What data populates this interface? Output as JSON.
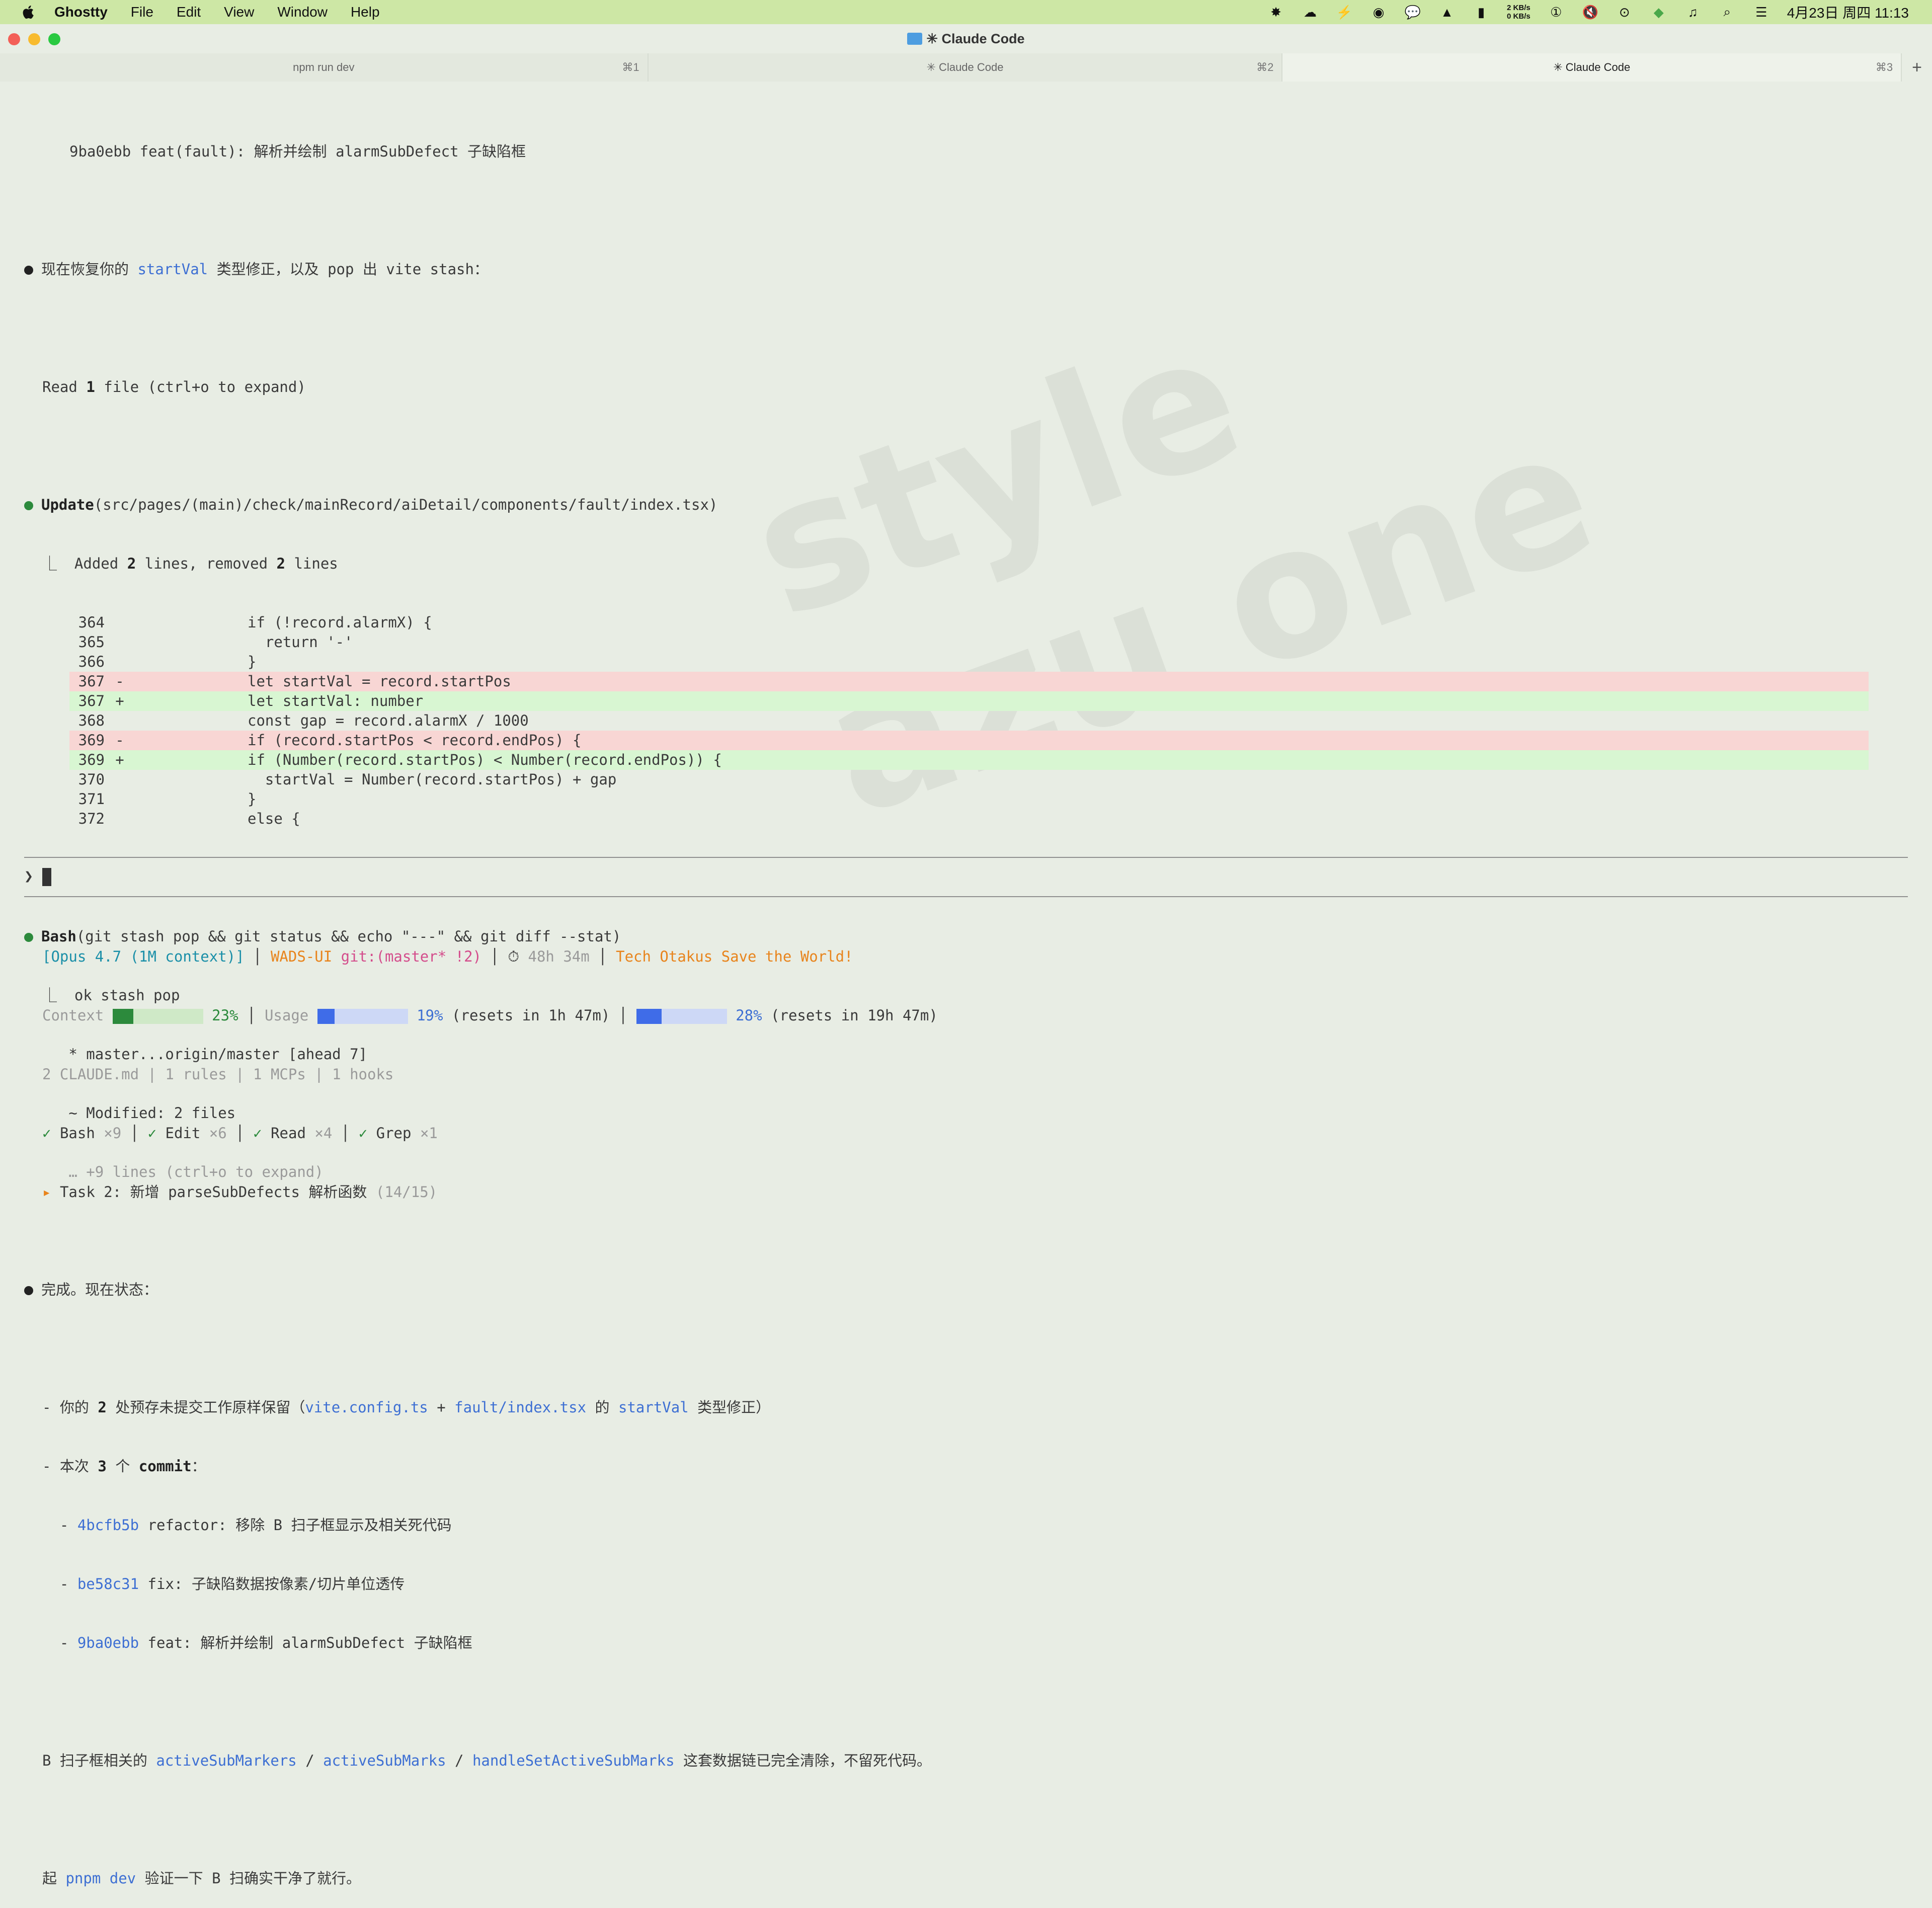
{
  "menubar": {
    "app_name": "Ghostty",
    "menus": [
      "File",
      "Edit",
      "View",
      "Window",
      "Help"
    ],
    "net_up": "2 KB/s",
    "net_down": "0 KB/s",
    "datetime": "4月23日 周四 11:13",
    "status_icons": [
      "claude-icon",
      "cloud-icon",
      "bolt-icon",
      "robot-icon",
      "chat-icon",
      "drive-icon",
      "chart-icon",
      "password-icon",
      "mute-icon",
      "record-icon",
      "wifi-icon",
      "music-icon",
      "search-icon",
      "control-center-icon"
    ]
  },
  "window": {
    "title": "✳ Claude Code"
  },
  "tabs": [
    {
      "label": "npm run dev",
      "shortcut": "⌘1"
    },
    {
      "label": "✳ Claude Code",
      "shortcut": "⌘2"
    },
    {
      "label": "✳ Claude Code",
      "shortcut": "⌘3"
    }
  ],
  "terminal": {
    "l1": "9ba0ebb feat(fault): 解析并绘制 alarmSubDefect 子缺陷框",
    "l2a": "现在恢复你的 ",
    "l2b": "startVal",
    "l2c": " 类型修正，以及 pop 出 vite stash：",
    "l3a": "Read ",
    "l3b": "1",
    "l3c": " file (ctrl+o to expand)",
    "update_a": "Update",
    "update_b": "(src/pages/(main)/check/mainRecord/aiDetail/components/fault/index.tsx)",
    "added_a": "⎿  Added ",
    "added_b": "2",
    "added_c": " lines, removed ",
    "added_d": "2",
    "added_e": " lines",
    "diff": [
      {
        "n": "364",
        "m": " ",
        "code": "if (!record.alarmX) {"
      },
      {
        "n": "365",
        "m": " ",
        "code": "  return '-'"
      },
      {
        "n": "366",
        "m": " ",
        "code": "}"
      },
      {
        "n": "367",
        "m": "-",
        "code": "let startVal = record.startPos"
      },
      {
        "n": "367",
        "m": "+",
        "code": "let startVal: number"
      },
      {
        "n": "368",
        "m": " ",
        "code": "const gap = record.alarmX / 1000"
      },
      {
        "n": "369",
        "m": "-",
        "code": "if (record.startPos < record.endPos) {"
      },
      {
        "n": "369",
        "m": "+",
        "code": "if (Number(record.startPos) < Number(record.endPos)) {"
      },
      {
        "n": "370",
        "m": " ",
        "code": "  startVal = Number(record.startPos) + gap"
      },
      {
        "n": "371",
        "m": " ",
        "code": "}"
      },
      {
        "n": "372",
        "m": " ",
        "code": "else {"
      }
    ],
    "bash_a": "Bash",
    "bash_b": "(git stash pop && git status && echo \"---\" && git diff --stat)",
    "bash_out1": "⎿  ok stash pop",
    "bash_out2": "   * master...origin/master [ahead 7]",
    "bash_out3": "   ~ Modified: 2 files",
    "bash_out4": "   … +9 lines (ctrl+o to expand)",
    "done": "完成。现在状态：",
    "s1a": "- 你的 ",
    "s1b": "2",
    "s1c": " 处预存未提交工作原样保留（",
    "s1d": "vite.config.ts",
    "s1e": " + ",
    "s1f": "fault/index.tsx",
    "s1g": " 的 ",
    "s1h": "startVal",
    "s1i": " 类型修正）",
    "s2a": "- 本次 ",
    "s2b": "3",
    "s2c": " 个 ",
    "s2d": "commit",
    "s2e": "：",
    "c1a": "  - ",
    "c1b": "4bcfb5b",
    "c1c": " refactor: 移除 B 扫子框显示及相关死代码",
    "c2a": "  - ",
    "c2b": "be58c31",
    "c2c": " fix: 子缺陷数据按像素/切片单位透传",
    "c3a": "  - ",
    "c3b": "9ba0ebb",
    "c3c": " feat: 解析并绘制 alarmSubDefect 子缺陷框",
    "b1a": "B 扫子框相关的 ",
    "b1b": "activeSubMarkers",
    "b1c": " / ",
    "b1d": "activeSubMarks",
    "b1e": " / ",
    "b1f": "handleSetActiveSubMarks",
    "b1g": " 这套数据链已完全清除，不留死代码。",
    "q1a": "起 ",
    "q1b": "pnpm dev",
    "q1c": " 验证一下 B 扫确实干净了就行。",
    "prompt": "❯"
  },
  "status": {
    "model": "[Opus 4.7 (1M context)]",
    "project": "WADS-UI",
    "git": "git:(master* !2)",
    "timer": "48h 34m",
    "slogan": "Tech Otakus Save the World!",
    "context_label": "Context",
    "context_pct": "23%",
    "context_value": 0.23,
    "usage_label": "Usage",
    "usage_pct": "19%",
    "usage_value": 0.19,
    "usage_reset": "(resets in 1h 47m)",
    "usage2_pct": "28%",
    "usage2_value": 0.28,
    "usage2_reset": "(resets in 19h 47m)",
    "info": "2 CLAUDE.md | 1 rules | 1 MCPs | 1 hooks",
    "tools": [
      {
        "name": "Bash",
        "count": "×9"
      },
      {
        "name": "Edit",
        "count": "×6"
      },
      {
        "name": "Read",
        "count": "×4"
      },
      {
        "name": "Grep",
        "count": "×1"
      }
    ],
    "task": "Task 2: 新增 parseSubDefects 解析函数",
    "task_progress": "(14/15)"
  },
  "colors": {
    "menubar_bg": "#cde7a5",
    "term_bg": "#e8ede4",
    "link_blue": "#3d6fd3",
    "diff_red_bg": "#f8d6d4",
    "diff_green_bg": "#d8f6d2",
    "bar_fill": "#2c8a3c",
    "bar_fill_blue": "#3f6ce8"
  }
}
